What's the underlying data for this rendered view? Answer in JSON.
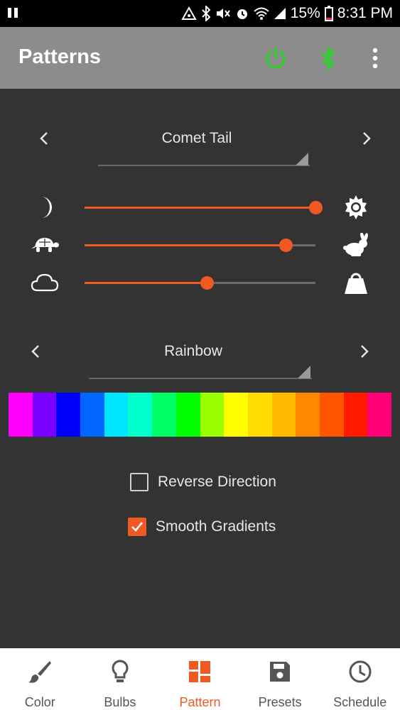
{
  "status_bar": {
    "battery": "15%",
    "time": "8:31 PM"
  },
  "app_bar": {
    "title": "Patterns"
  },
  "pattern_selector": {
    "value": "Comet Tail"
  },
  "sliders": [
    {
      "name": "brightness",
      "left_icon": "moon-icon",
      "right_icon": "sun-icon",
      "level": 1.0
    },
    {
      "name": "speed",
      "left_icon": "turtle-icon",
      "right_icon": "rabbit-icon",
      "level": 0.87
    },
    {
      "name": "weight",
      "left_icon": "cloud-icon",
      "right_icon": "weight-icon",
      "level": 0.53
    }
  ],
  "palette_selector": {
    "value": "Rainbow",
    "swatches": [
      "#ff00ff",
      "#7a00ff",
      "#0000ff",
      "#0066ff",
      "#00e5ff",
      "#00ffcc",
      "#00ff66",
      "#00ff00",
      "#99ff00",
      "#ffff00",
      "#ffdd00",
      "#ffbb00",
      "#ff8800",
      "#ff5500",
      "#ff1a00",
      "#ff0077"
    ]
  },
  "options": {
    "reverse": {
      "label": "Reverse Direction",
      "checked": false
    },
    "smooth": {
      "label": "Smooth Gradients",
      "checked": true
    }
  },
  "nav": {
    "items": [
      {
        "label": "Color",
        "icon": "brush-icon",
        "active": false
      },
      {
        "label": "Bulbs",
        "icon": "bulb-icon",
        "active": false
      },
      {
        "label": "Pattern",
        "icon": "pattern-icon",
        "active": true
      },
      {
        "label": "Presets",
        "icon": "save-icon",
        "active": false
      },
      {
        "label": "Schedule",
        "icon": "clock-icon",
        "active": false
      }
    ]
  },
  "colors": {
    "accent": "#f05a22",
    "active_green": "#2fd12f",
    "app_bar": "#8c8c8c",
    "background": "#333333"
  }
}
